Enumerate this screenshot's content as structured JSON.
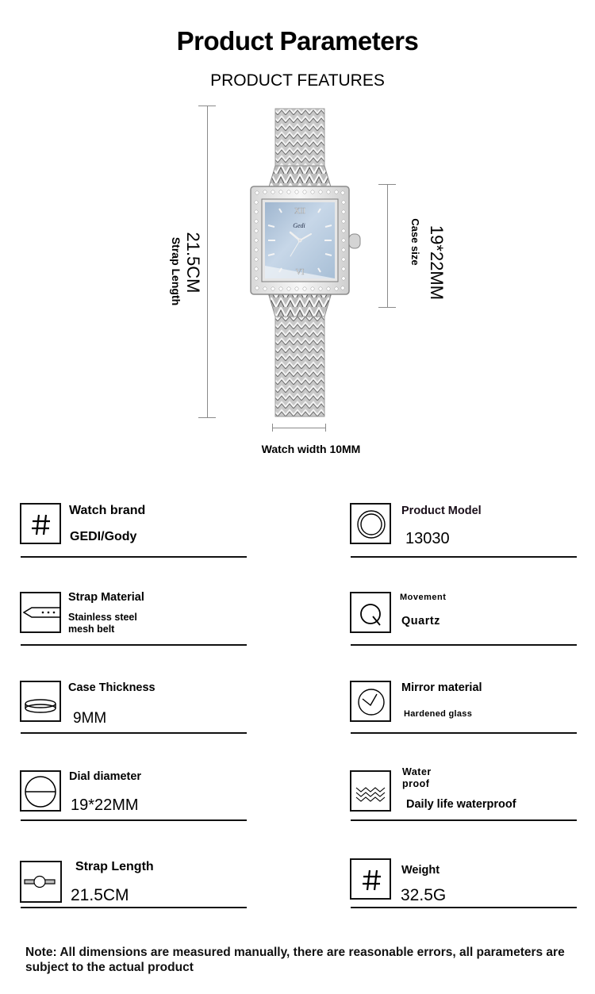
{
  "header": {
    "title": "Product Parameters",
    "subtitle": "PRODUCT FEATURES"
  },
  "illustration": {
    "brand_on_dial": "Gedi",
    "dial_color": "#b9cde0",
    "strap_length_value": "21.5CM",
    "strap_length_label": "Strap Length",
    "case_size_value": "19*22MM",
    "case_size_label": "Case size",
    "width_caption": "Watch width 10MM"
  },
  "specs": {
    "left": [
      {
        "icon": "hash-icon",
        "label": "Watch brand",
        "value": "GEDI/Gody"
      },
      {
        "icon": "strap-buckle-icon",
        "label": "Strap Material",
        "value": "Stainless steel mesh belt"
      },
      {
        "icon": "case-thickness-icon",
        "label": "Case Thickness",
        "value": "9MM"
      },
      {
        "icon": "dial-diameter-icon",
        "label": "Dial diameter",
        "value": "19*22MM"
      },
      {
        "icon": "strap-length-icon",
        "label": "Strap Length",
        "value": "21.5CM"
      }
    ],
    "right": [
      {
        "icon": "double-circle-icon",
        "label": "Product Model",
        "value": "13030"
      },
      {
        "icon": "quartz-q-icon",
        "label": "Movement",
        "value": "Quartz"
      },
      {
        "icon": "clock-check-icon",
        "label": "Mirror material",
        "value": "Hardened glass"
      },
      {
        "icon": "waves-icon",
        "label": "Water proof",
        "value": "Daily life waterproof"
      },
      {
        "icon": "hash-icon",
        "label": "Weight",
        "value": "32.5G"
      }
    ]
  },
  "note": "Note: All dimensions are measured manually, there are reasonable errors, all parameters are subject to the actual product"
}
